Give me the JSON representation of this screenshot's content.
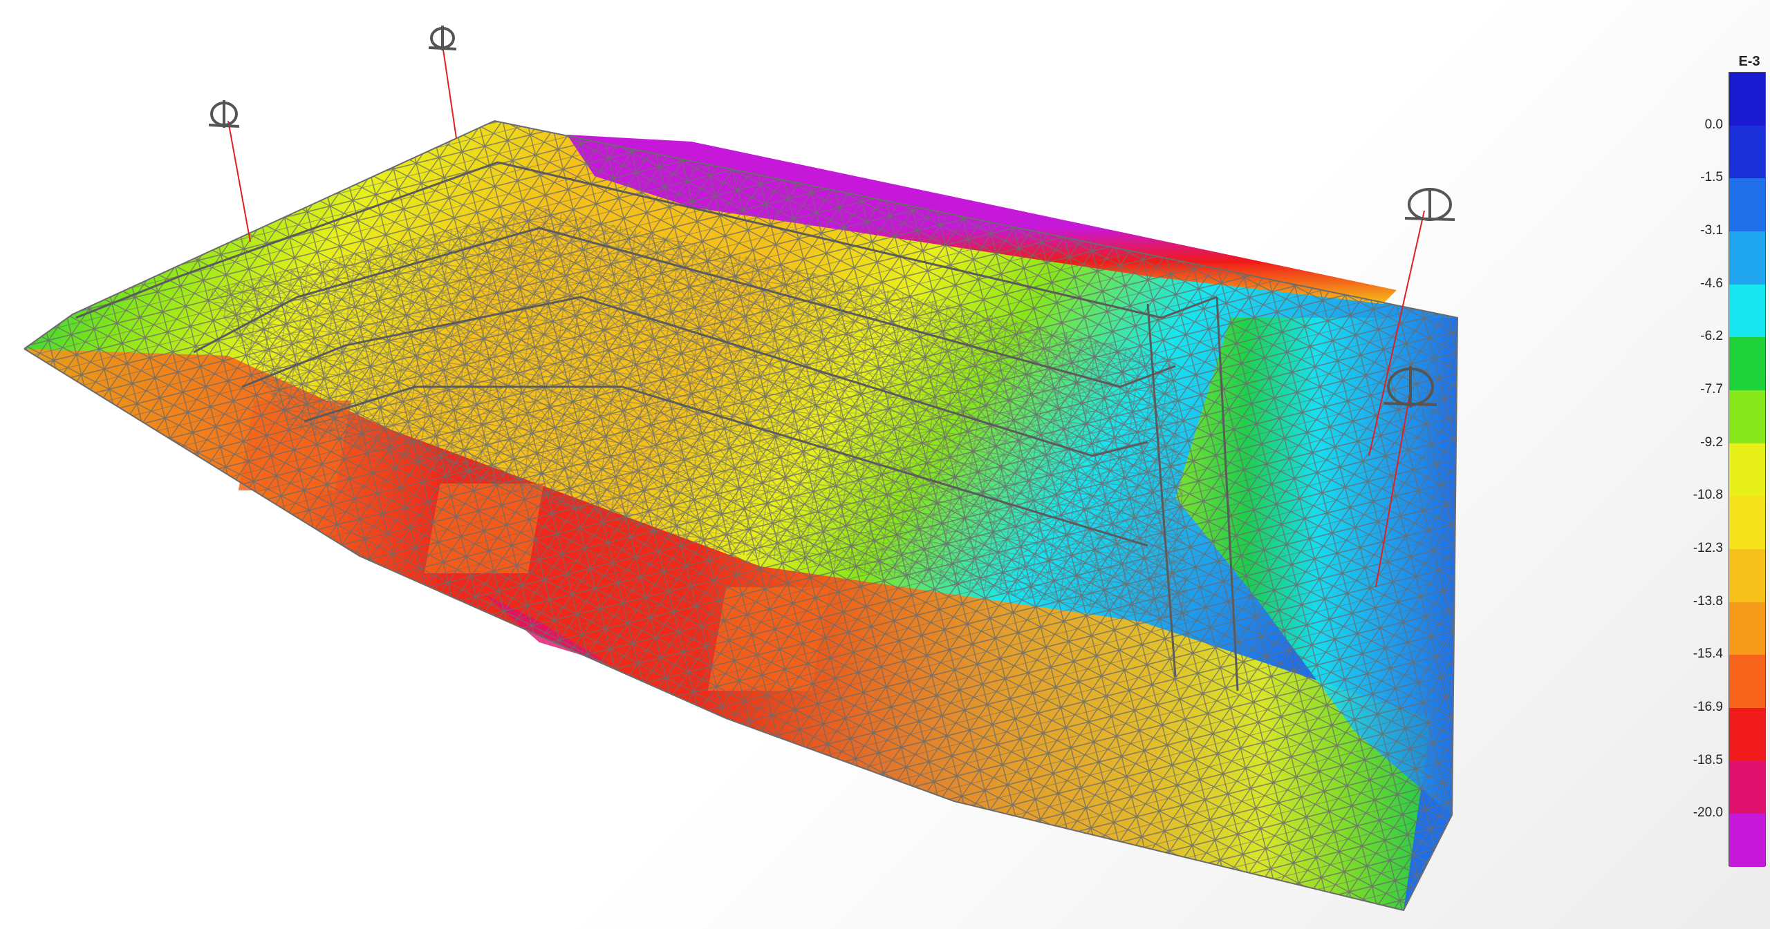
{
  "legend": {
    "unit": "E-3",
    "ticks": [
      "0.0",
      "-1.5",
      "-3.1",
      "-4.6",
      "-6.2",
      "-7.7",
      "-9.2",
      "-10.8",
      "-12.3",
      "-13.8",
      "-15.4",
      "-16.9",
      "-18.5",
      "-20.0"
    ],
    "colors": [
      "#1a2fd8",
      "#1f6fe8",
      "#1fa6ee",
      "#17e6f0",
      "#1fd23a",
      "#86e61a",
      "#e8f01a",
      "#f5e21a",
      "#f5c01a",
      "#f59a1a",
      "#f5641a",
      "#f01a1a",
      "#e0106e",
      "#c618d8"
    ]
  },
  "supports": {
    "icon": "support-spring-icon",
    "count": 4
  }
}
